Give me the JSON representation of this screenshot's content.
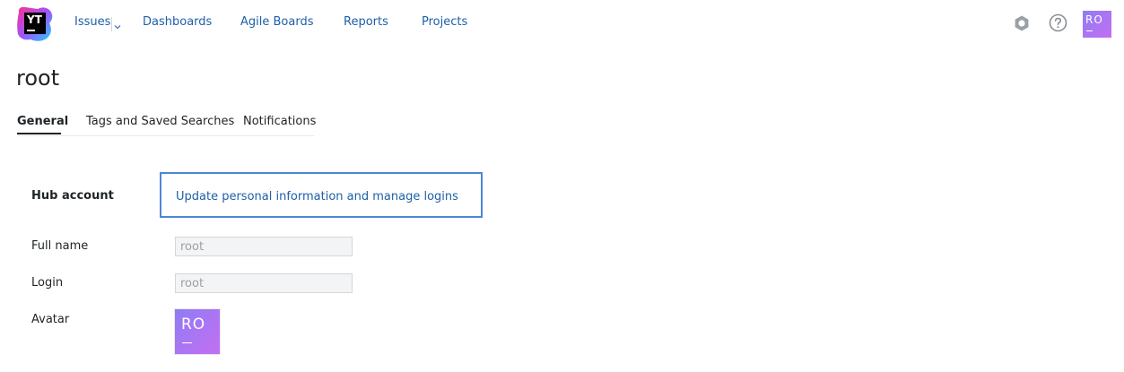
{
  "header": {
    "logo_text": "YT",
    "nav": {
      "issues": "Issues",
      "dashboards": "Dashboards",
      "agile_boards": "Agile Boards",
      "reports": "Reports",
      "projects": "Projects"
    },
    "icons": [
      "hub-icon",
      "help-icon"
    ],
    "user_initials": "RO"
  },
  "page": {
    "title": "root",
    "tabs": [
      {
        "label": "General",
        "active": true
      },
      {
        "label": "Tags and Saved Searches",
        "active": false
      },
      {
        "label": "Notifications",
        "active": false
      }
    ]
  },
  "form": {
    "hub_account_label": "Hub account",
    "hub_account_link": "Update personal information and manage logins",
    "full_name_label": "Full name",
    "full_name_value": "root",
    "login_label": "Login",
    "login_value": "root",
    "avatar_label": "Avatar",
    "avatar_initials": "RO"
  },
  "colors": {
    "link": "#1e5fa8",
    "focus_border": "#4c86d9",
    "avatar_gradient_start": "#8f7cf4",
    "avatar_gradient_end": "#c46ff2"
  }
}
